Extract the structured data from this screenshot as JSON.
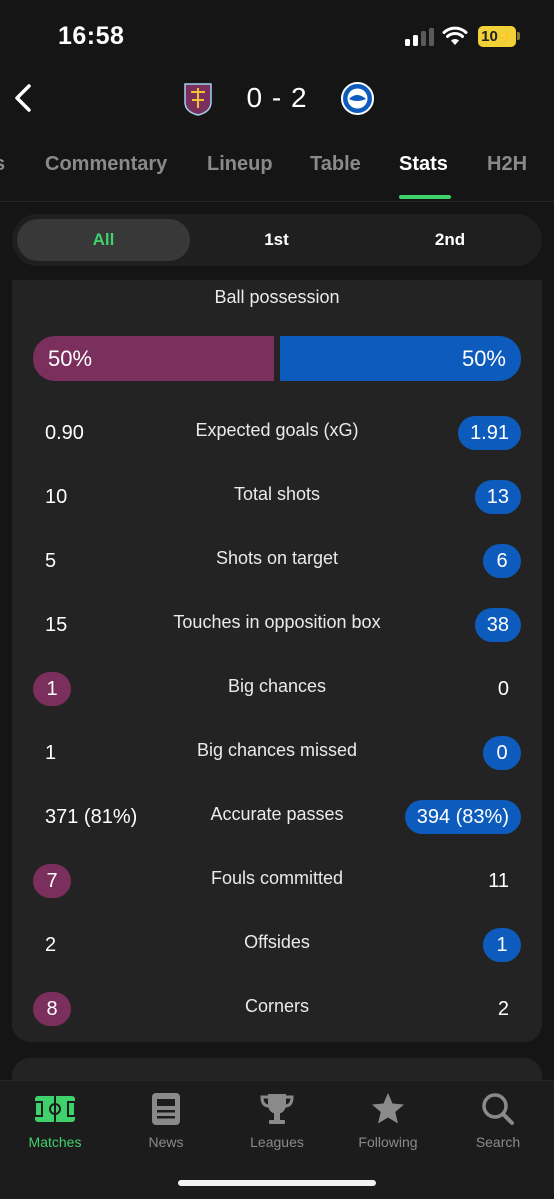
{
  "status_bar": {
    "time": "16:58",
    "battery": "10"
  },
  "match": {
    "home_team": "Burnley",
    "away_team": "Brighton",
    "score": "0 - 2"
  },
  "tabs": [
    {
      "label": "s"
    },
    {
      "label": "Commentary"
    },
    {
      "label": "Lineup"
    },
    {
      "label": "Table"
    },
    {
      "label": "Stats"
    },
    {
      "label": "H2H"
    }
  ],
  "segments": [
    {
      "label": "All"
    },
    {
      "label": "1st"
    },
    {
      "label": "2nd"
    }
  ],
  "possession": {
    "title": "Ball possession",
    "home": "50%",
    "away": "50%"
  },
  "stats": [
    {
      "label": "Expected goals (xG)",
      "home": "0.90",
      "away": "1.91",
      "highlight": "away"
    },
    {
      "label": "Total shots",
      "home": "10",
      "away": "13",
      "highlight": "away"
    },
    {
      "label": "Shots on target",
      "home": "5",
      "away": "6",
      "highlight": "away"
    },
    {
      "label": "Touches in opposition box",
      "home": "15",
      "away": "38",
      "highlight": "away"
    },
    {
      "label": "Big chances",
      "home": "1",
      "away": "0",
      "highlight": "home"
    },
    {
      "label": "Big chances missed",
      "home": "1",
      "away": "0",
      "highlight": "away"
    },
    {
      "label": "Accurate passes",
      "home": "371 (81%)",
      "away": "394 (83%)",
      "highlight": "away"
    },
    {
      "label": "Fouls committed",
      "home": "7",
      "away": "11",
      "highlight": "home"
    },
    {
      "label": "Offsides",
      "home": "2",
      "away": "1",
      "highlight": "away"
    },
    {
      "label": "Corners",
      "home": "8",
      "away": "2",
      "highlight": "home"
    }
  ],
  "bottom_nav": [
    {
      "label": "Matches",
      "icon": "pitch-icon"
    },
    {
      "label": "News",
      "icon": "news-icon"
    },
    {
      "label": "Leagues",
      "icon": "trophy-icon"
    },
    {
      "label": "Following",
      "icon": "star-icon"
    },
    {
      "label": "Search",
      "icon": "search-icon"
    }
  ],
  "colors": {
    "home": "#7a2f5c",
    "away": "#0d5cbd",
    "accent": "#3fd16b"
  }
}
